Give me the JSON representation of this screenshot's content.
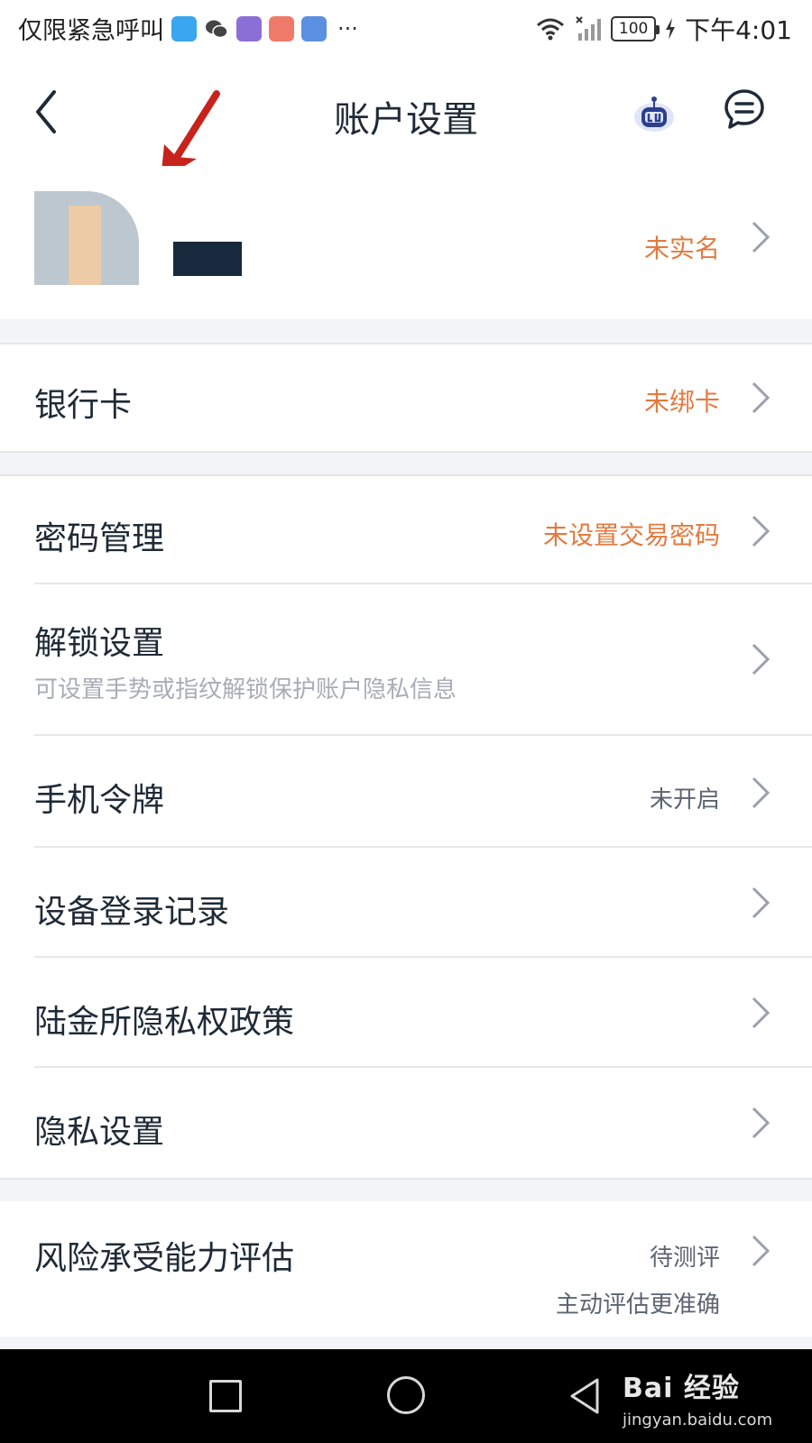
{
  "status_bar": {
    "carrier_text": "仅限紧急呼叫",
    "app_icons": [
      "shield-app-icon",
      "wechat-icon",
      "browser-icon",
      "lollipop-app-icon",
      "chart-app-icon"
    ],
    "more": "···",
    "battery": "100",
    "time": "下午4:01"
  },
  "nav": {
    "title": "账户设置"
  },
  "profile": {
    "status": "未实名"
  },
  "bank": {
    "label": "银行卡",
    "value": "未绑卡"
  },
  "security": {
    "items": [
      {
        "label": "密码管理",
        "value": "未设置交易密码"
      },
      {
        "label": "解锁设置",
        "sub": "可设置手势或指纹解锁保护账户隐私信息"
      },
      {
        "label": "手机令牌",
        "value": "未开启"
      },
      {
        "label": "设备登录记录"
      },
      {
        "label": "陆金所隐私权政策"
      },
      {
        "label": "隐私设置"
      }
    ]
  },
  "risk": {
    "label": "风险承受能力评估",
    "value": "待测评",
    "hint": "主动评估更准确"
  },
  "watermark": {
    "main": "Bai 经验",
    "sub": "jingyan.baidu.com"
  },
  "colors": {
    "accent_orange": "#e27a3f",
    "text_dark": "#1f2a36",
    "subtext_gray": "#a8adb4",
    "section_bg": "#f3f4f7"
  }
}
